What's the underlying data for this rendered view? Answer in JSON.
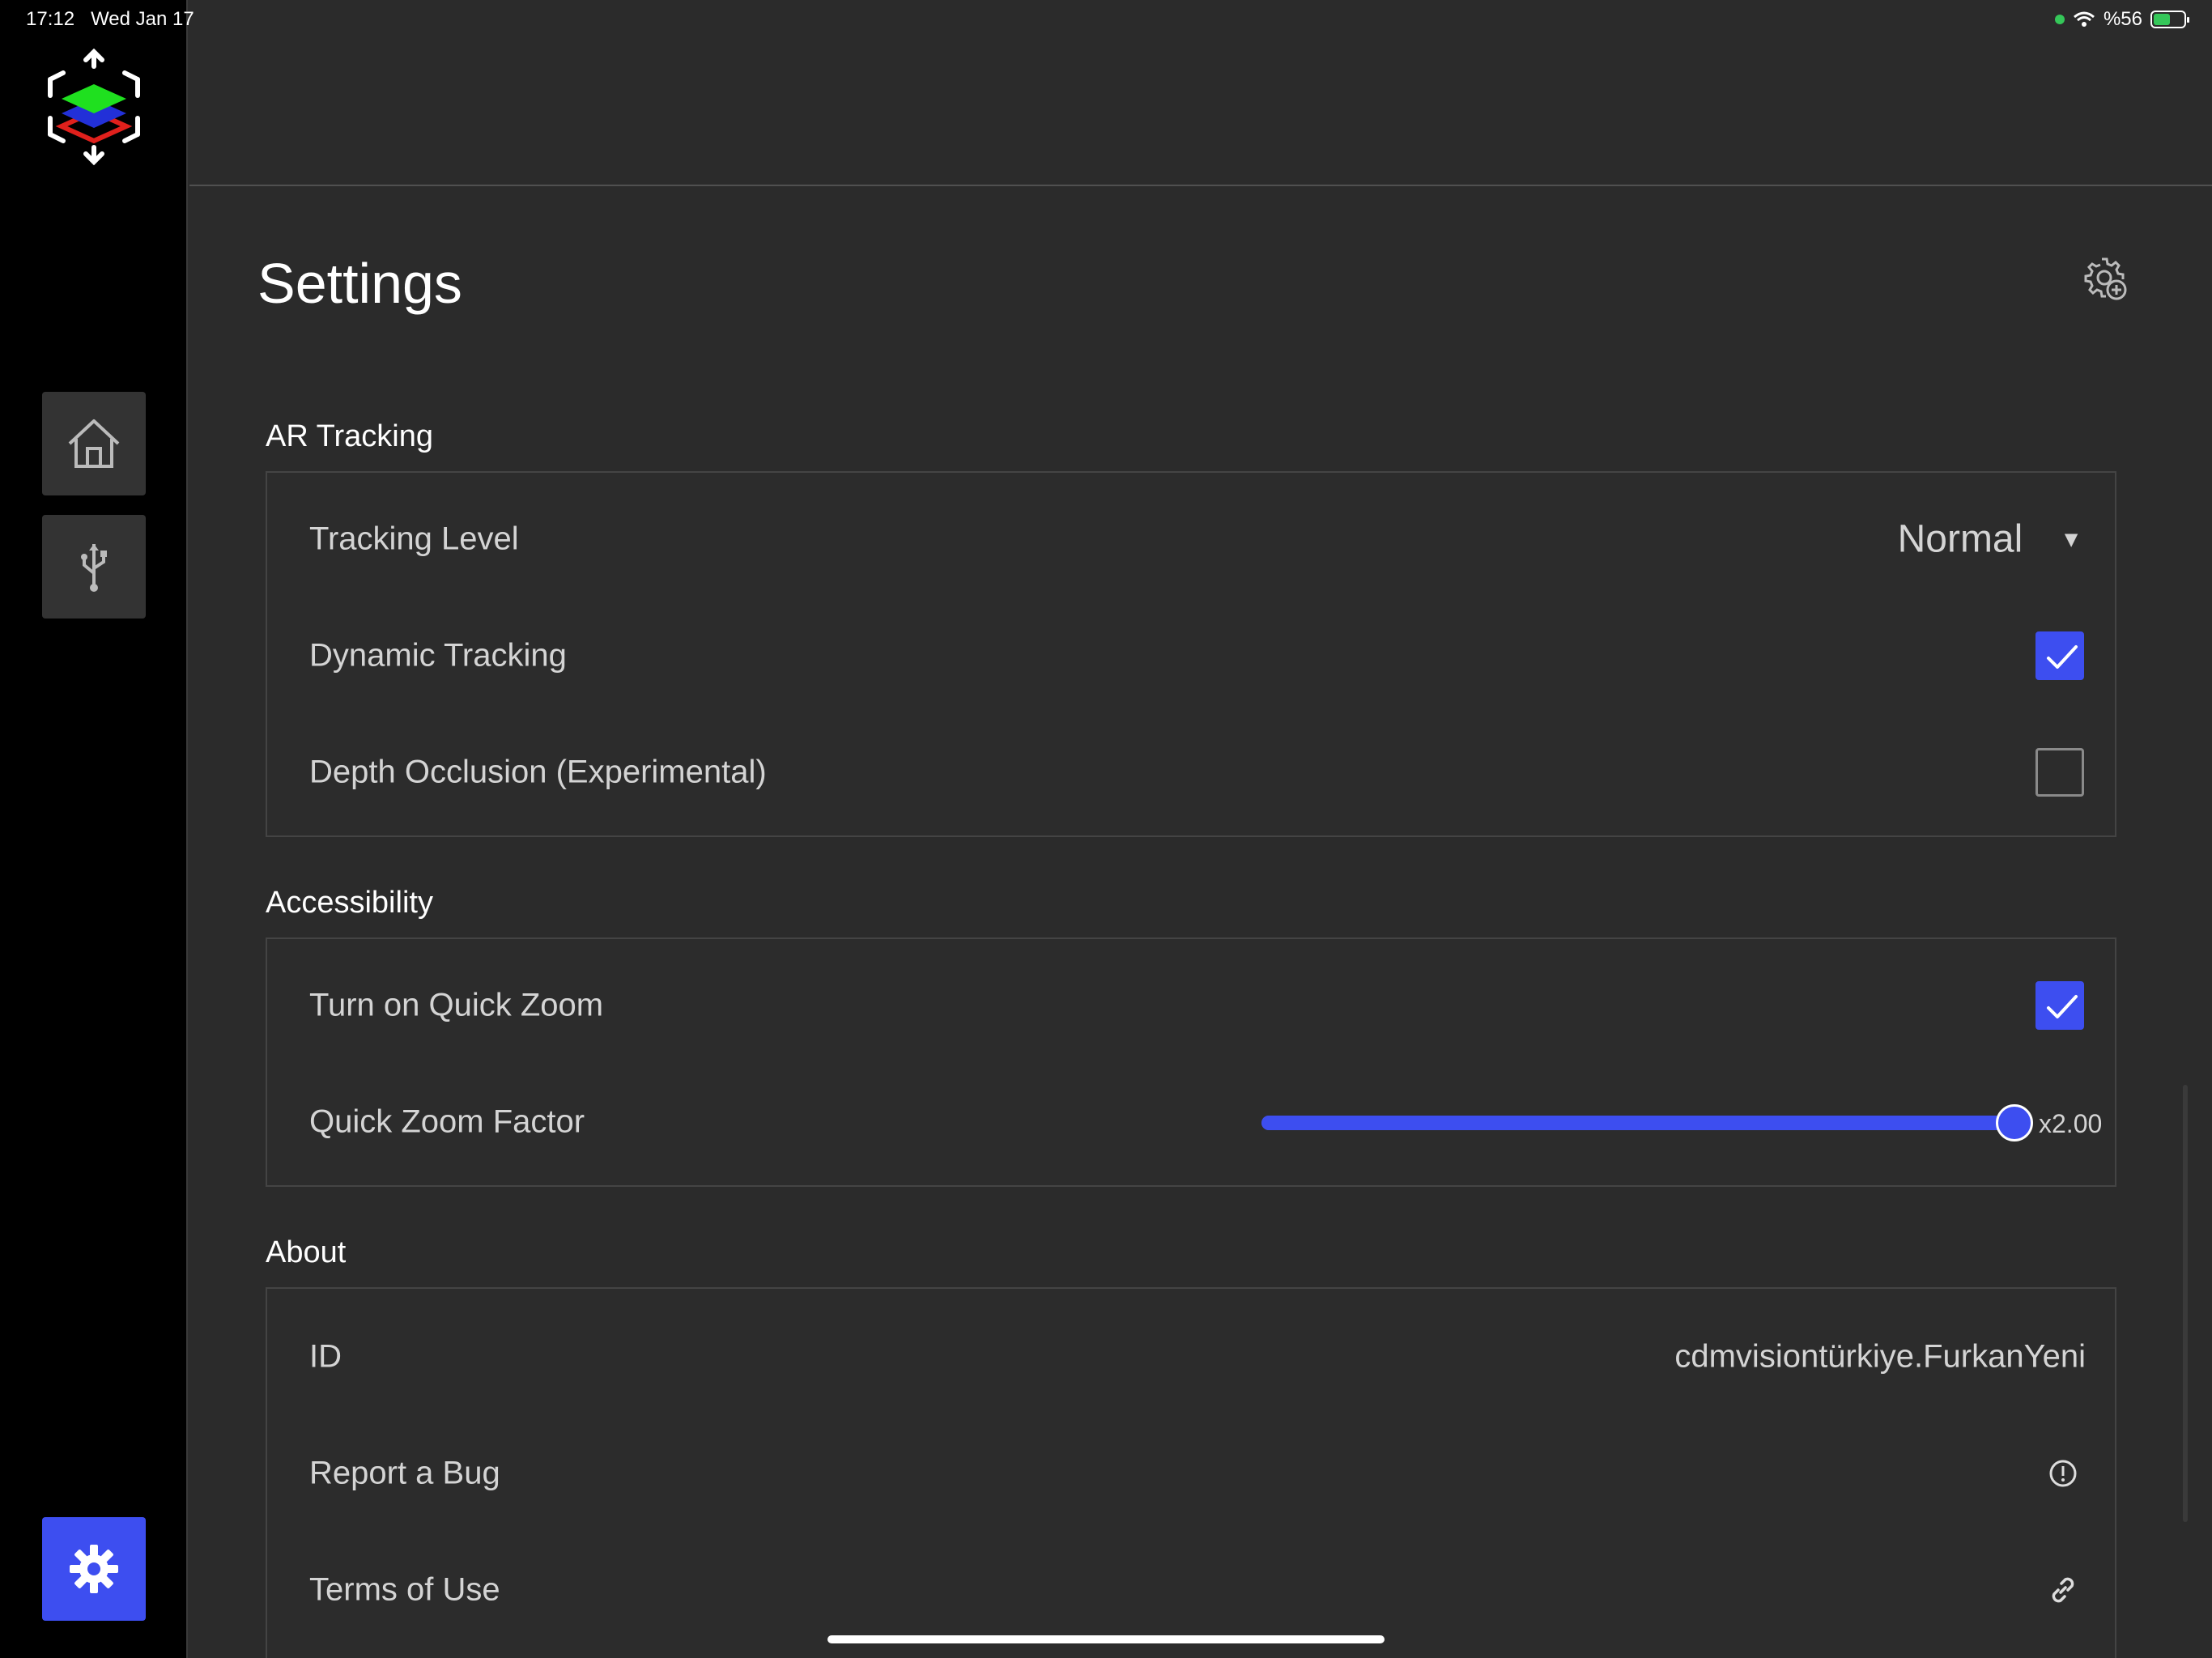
{
  "status_bar": {
    "time": "17:12",
    "date": "Wed Jan 17",
    "battery_label": "%56",
    "battery_level": 0.56
  },
  "sidebar": {
    "items": [
      {
        "name": "home",
        "icon": "home-icon"
      },
      {
        "name": "usb",
        "icon": "usb-icon"
      },
      {
        "name": "settings",
        "icon": "gear-icon",
        "active": true
      }
    ]
  },
  "page": {
    "title": "Settings"
  },
  "sections": {
    "ar_tracking": {
      "title": "AR Tracking",
      "tracking_level": {
        "label": "Tracking Level",
        "value": "Normal"
      },
      "dynamic_tracking": {
        "label": "Dynamic Tracking",
        "checked": true
      },
      "depth_occlusion": {
        "label": "Depth Occlusion (Experimental)",
        "checked": false
      }
    },
    "accessibility": {
      "title": "Accessibility",
      "quick_zoom": {
        "label": "Turn on Quick Zoom",
        "checked": true
      },
      "quick_zoom_factor": {
        "label": "Quick Zoom Factor",
        "value_label": "x2.00",
        "fraction": 1.0
      }
    },
    "about": {
      "title": "About",
      "id": {
        "label": "ID",
        "value": "cdmvisiontürkiye.FurkanYeni"
      },
      "report_bug": {
        "label": "Report a Bug"
      },
      "terms": {
        "label": "Terms of Use"
      }
    }
  },
  "colors": {
    "accent": "#3d4ef0",
    "background": "#2b2b2b",
    "sidebar": "#000000"
  }
}
